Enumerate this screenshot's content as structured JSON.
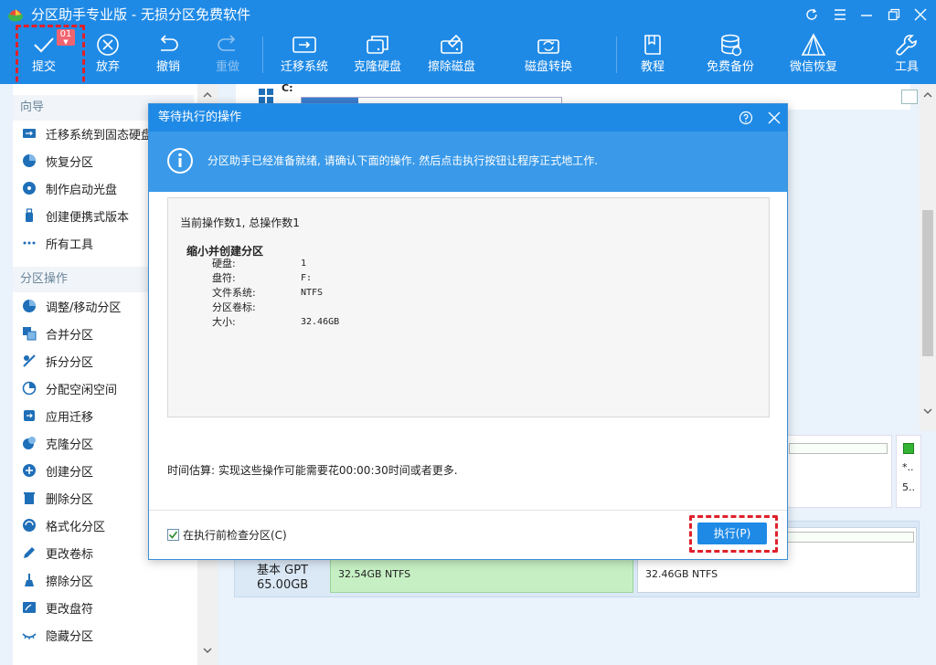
{
  "titlebar": {
    "title": "分区助手专业版 - 无损分区免费软件"
  },
  "toolbar": {
    "submit": "提交",
    "pending_count": "01",
    "discard": "放弃",
    "undo": "撤销",
    "redo": "重做",
    "migrate_os": "迁移系统",
    "clone_disk": "克隆硬盘",
    "wipe_disk": "擦除磁盘",
    "disk_convert": "磁盘转换",
    "tutorial": "教程",
    "free_backup": "免费备份",
    "wechat_recovery": "微信恢复",
    "tools": "工具"
  },
  "sidebar": {
    "wizard_title": "向导",
    "wizard_items": [
      "迁移系统到固态硬盘",
      "恢复分区",
      "制作启动光盘",
      "创建便携式版本",
      "所有工具"
    ],
    "partition_title": "分区操作",
    "partition_items": [
      "调整/移动分区",
      "合并分区",
      "拆分分区",
      "分配空闲空间",
      "应用迁移",
      "克隆分区",
      "创建分区",
      "删除分区",
      "格式化分区",
      "更改卷标",
      "擦除分区",
      "更改盘符",
      "隐藏分区"
    ]
  },
  "main": {
    "drive_c": "C:",
    "disk_type": "基本 GPT",
    "disk_size": "65.00GB",
    "partition1": "32.54GB NTFS",
    "partition2": "32.46GB NTFS",
    "side_star": "*..",
    "side_num": "5.."
  },
  "dialog": {
    "title": "等待执行的操作",
    "info": "分区助手已经准备就绪, 请确认下面的操作. 然后点击执行按钮让程序正式地工作.",
    "ops_header": "当前操作数1, 总操作数1",
    "op_title": "缩小并创建分区",
    "rows": [
      {
        "label": "硬盘:",
        "value": "1"
      },
      {
        "label": "盘符:",
        "value": "F:"
      },
      {
        "label": "文件系统:",
        "value": "NTFS"
      },
      {
        "label": "分区卷标:",
        "value": ""
      },
      {
        "label": "大小:",
        "value": "32.46GB"
      }
    ],
    "estimate": "时间估算: 实现这些操作可能需要花00:00:30时间或者更多.",
    "check_label": "在执行前检查分区(C)",
    "check_checked": true,
    "execute": "执行(P)"
  },
  "colors": {
    "brand": "#1f8ae6",
    "info_bar": "#3a9ae9",
    "highlight_dash": "#e0202a",
    "partition_green": "#c6f0c4"
  }
}
